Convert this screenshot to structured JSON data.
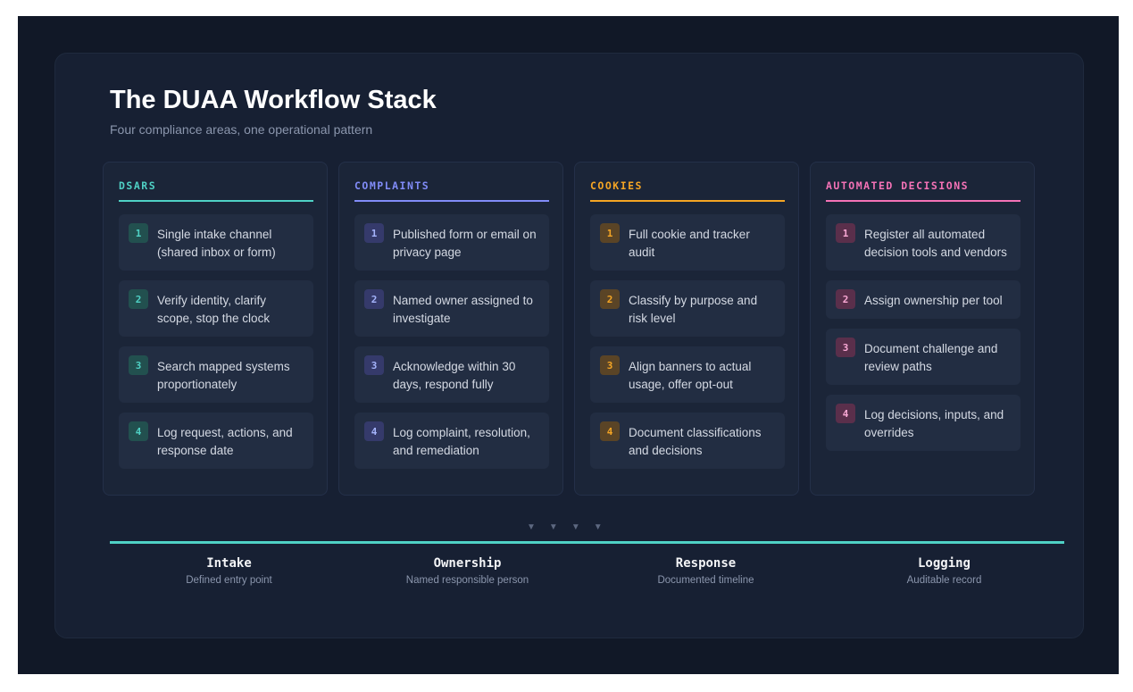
{
  "title": "The DUAA Workflow Stack",
  "subtitle": "Four compliance areas, one operational pattern",
  "columns": [
    {
      "heading": "DSARS",
      "accent": "#4fd1c5",
      "steps": [
        {
          "num": "1",
          "text": "Single intake channel (shared inbox or form)"
        },
        {
          "num": "2",
          "text": "Verify identity, clarify scope, stop the clock"
        },
        {
          "num": "3",
          "text": "Search mapped systems proportionately"
        },
        {
          "num": "4",
          "text": "Log request, actions, and response date"
        }
      ]
    },
    {
      "heading": "COMPLAINTS",
      "accent": "#818cf8",
      "steps": [
        {
          "num": "1",
          "text": "Published form or email on privacy page"
        },
        {
          "num": "2",
          "text": "Named owner assigned to investigate"
        },
        {
          "num": "3",
          "text": "Acknowledge within 30 days, respond fully"
        },
        {
          "num": "4",
          "text": "Log complaint, resolution, and remediation"
        }
      ]
    },
    {
      "heading": "COOKIES",
      "accent": "#f5a524",
      "steps": [
        {
          "num": "1",
          "text": "Full cookie and tracker audit"
        },
        {
          "num": "2",
          "text": "Classify by purpose and risk level"
        },
        {
          "num": "3",
          "text": "Align banners to actual usage, offer opt-out"
        },
        {
          "num": "4",
          "text": "Document classifications and decisions"
        }
      ]
    },
    {
      "heading": "AUTOMATED DECISIONS",
      "accent": "#f472b6",
      "steps": [
        {
          "num": "1",
          "text": "Register all automated decision tools and vendors"
        },
        {
          "num": "2",
          "text": "Assign ownership per tool"
        },
        {
          "num": "3",
          "text": "Document challenge and review paths"
        },
        {
          "num": "4",
          "text": "Log decisions, inputs, and overrides"
        }
      ]
    }
  ],
  "arrows": [
    "▼",
    "▼",
    "▼",
    "▼"
  ],
  "stages": [
    {
      "title": "Intake",
      "desc": "Defined entry point"
    },
    {
      "title": "Ownership",
      "desc": "Named responsible person"
    },
    {
      "title": "Response",
      "desc": "Documented timeline"
    },
    {
      "title": "Logging",
      "desc": "Auditable record"
    }
  ],
  "colors": {
    "background": "#111827",
    "panel": "#172033",
    "stage_line": "#4fd1c5"
  }
}
